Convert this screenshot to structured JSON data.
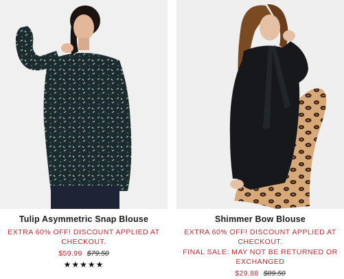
{
  "products": [
    {
      "name": "Tulip Asymmetric Snap Blouse",
      "promo": "EXTRA 60% OFF! DISCOUNT APPLIED AT CHECKOUT.",
      "sale_price": "$59.99",
      "original_price": "$79.50",
      "rating_stars": "★★★★★",
      "rating_value": 5
    },
    {
      "name": "Shimmer Bow Blouse",
      "promo": "EXTRA 60% OFF! DISCOUNT APPLIED AT CHECKOUT.",
      "final_sale": "FINAL SALE: MAY NOT BE RETURNED OR EXCHANGED",
      "sale_price": "$29.88",
      "original_price": "$89.50"
    }
  ]
}
